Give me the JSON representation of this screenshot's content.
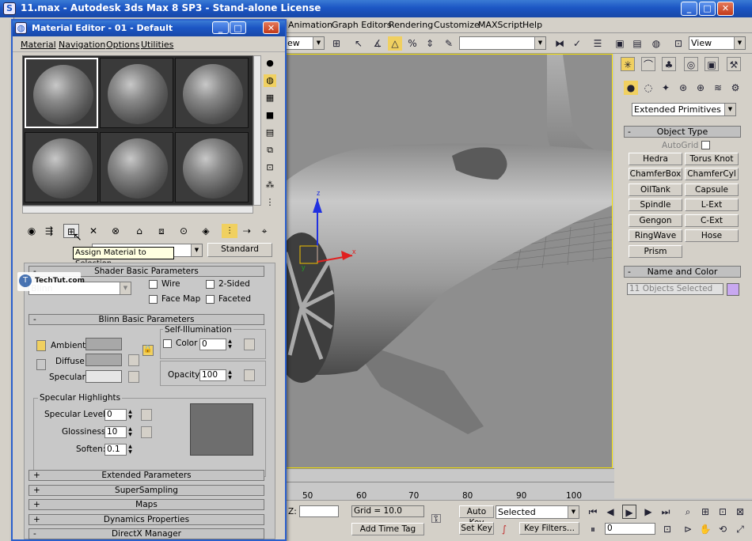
{
  "app": {
    "title": "11.max - Autodesk 3ds Max 8 SP3 - Stand-alone License"
  },
  "menu": [
    "Animation",
    "Graph Editors",
    "Rendering",
    "Customize",
    "MAXScript",
    "Help"
  ],
  "toolbar": {
    "view_left": "ew",
    "view_right": "View"
  },
  "cmd_panel": {
    "category": "Extended Primitives",
    "object_type_title": "Object Type",
    "autogrid": "AutoGrid",
    "buttons": [
      "Hedra",
      "Torus Knot",
      "ChamferBox",
      "ChamferCyl",
      "OilTank",
      "Capsule",
      "Spindle",
      "L-Ext",
      "Gengon",
      "C-Ext",
      "RingWave",
      "Hose",
      "Prism"
    ],
    "name_color_title": "Name and Color",
    "name_value": "11 Objects Selected",
    "swatch_color": "#c8a8f0"
  },
  "timeline": {
    "ticks": [
      "50",
      "60",
      "70",
      "80",
      "90",
      "100"
    ]
  },
  "status": {
    "z_label": "Z:",
    "grid": "Grid = 10.0",
    "add_time_tag": "Add Time Tag",
    "auto_key": "Auto Key",
    "set_key": "Set Key",
    "selected": "Selected",
    "key_filters": "Key Filters...",
    "frame": "0"
  },
  "material_editor": {
    "title": "Material Editor - 01 - Default",
    "menu": [
      "Material",
      "Navigation",
      "Options",
      "Utilities"
    ],
    "tooltip": "Assign Material to Selection",
    "standard": "Standard",
    "shader_title": "Shader Basic Parameters",
    "shader_value": "Blinn",
    "watermark": "TechTut.com",
    "wire": "Wire",
    "two_sided": "2-Sided",
    "face_map": "Face Map",
    "faceted": "Faceted",
    "blinn_title": "Blinn Basic Parameters",
    "self_illum": "Self-Illumination",
    "color": "Color",
    "color_value": "0",
    "ambient": "Ambient:",
    "diffuse": "Diffuse:",
    "specular": "Specular:",
    "opacity": "Opacity:",
    "opacity_value": "100",
    "spec_highlights": "Specular Highlights",
    "spec_level": "Specular Level:",
    "spec_level_value": "0",
    "glossiness": "Glossiness:",
    "glossiness_value": "10",
    "soften": "Soften:",
    "soften_value": "0.1",
    "rollouts": [
      "Extended Parameters",
      "SuperSampling",
      "Maps",
      "Dynamics Properties",
      "DirectX Manager"
    ],
    "minus": "-",
    "plus": "+"
  },
  "gizmo": {
    "x": "x",
    "y": "y",
    "z": "z"
  }
}
